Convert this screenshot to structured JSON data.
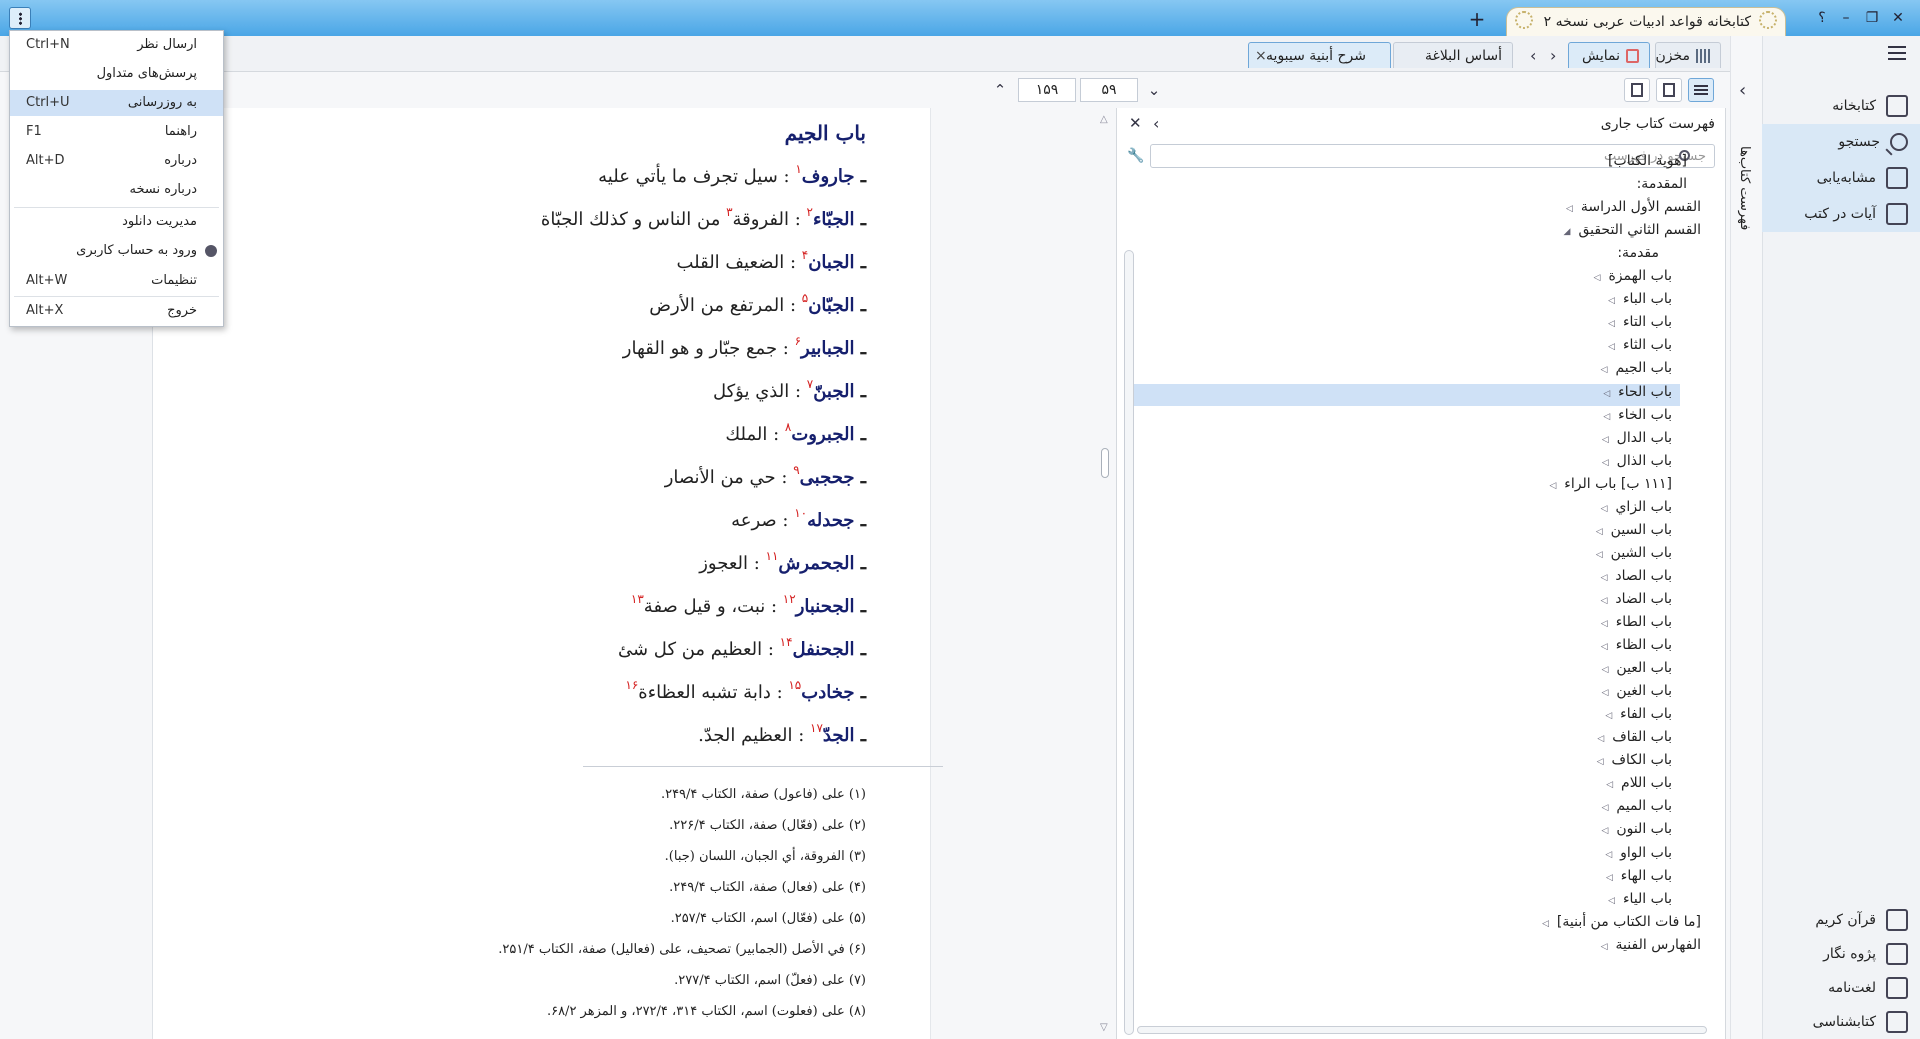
{
  "window": {
    "title": "کتابخانه قواعد ادبیات عربی نسخه ۲",
    "help": "؟",
    "minimize": "–",
    "restore": "❐",
    "close": "✕",
    "new_tab": "+"
  },
  "menu": {
    "items": [
      {
        "label": "ارسال نظر",
        "shortcut": "Ctrl+N"
      },
      {
        "label": "پرسش‌های متداول",
        "shortcut": ""
      },
      {
        "label": "به روزرسانی",
        "shortcut": "Ctrl+U"
      },
      {
        "label": "راهنما",
        "shortcut": "F1"
      },
      {
        "label": "درباره",
        "shortcut": "Alt+D"
      },
      {
        "label": "درباره نسخه",
        "shortcut": ""
      },
      {
        "label": "مدیریت دانلود",
        "shortcut": ""
      },
      {
        "label": "ورود به حساب کاربری",
        "shortcut": ""
      },
      {
        "label": "تنظیمات",
        "shortcut": "Alt+W"
      },
      {
        "label": "خروج",
        "shortcut": "Alt+X"
      }
    ]
  },
  "tabs": {
    "store": "مخزن",
    "display": "نمایش",
    "docs": [
      {
        "label": "أساس البلاغة"
      },
      {
        "label": "شرح أبنية سيبويه"
      }
    ],
    "close": "×"
  },
  "toolbar": {
    "page_current": "۵۹",
    "page_total": "۱۵۹"
  },
  "rightnav": {
    "top": [
      {
        "label": "کتابخانه"
      },
      {
        "label": "جستجو"
      },
      {
        "label": "مشابه‌یابی"
      },
      {
        "label": "آیات در کتب"
      }
    ],
    "bottom": [
      {
        "label": "قرآن کریم"
      },
      {
        "label": "پژوه نگار"
      },
      {
        "label": "لغت‌نامه"
      },
      {
        "label": "کتابشناسی"
      }
    ],
    "vertical_tab": "فهرست کتاب‌ها"
  },
  "toc": {
    "title": "فهرست کتاب جاری",
    "search_placeholder": "جستجو در فهرست",
    "items": [
      {
        "label": "[هوية الكتاب]",
        "level": 0,
        "tri": ""
      },
      {
        "label": "المقدمة:",
        "level": 0,
        "tri": ""
      },
      {
        "label": "القسم الأول الدراسة",
        "level": 0,
        "tri": "◁"
      },
      {
        "label": "القسم الثاني التحقيق",
        "level": 0,
        "tri": "◢"
      },
      {
        "label": "مقدمة:",
        "level": 1,
        "tri": ""
      },
      {
        "label": "باب الهمزة",
        "level": 1,
        "tri": "◁"
      },
      {
        "label": "باب الباء",
        "level": 1,
        "tri": "◁"
      },
      {
        "label": "باب التاء",
        "level": 1,
        "tri": "◁"
      },
      {
        "label": "باب الثاء",
        "level": 1,
        "tri": "◁"
      },
      {
        "label": "باب الجيم",
        "level": 1,
        "tri": "◁"
      },
      {
        "label": "باب الحاء",
        "level": 1,
        "tri": "◁"
      },
      {
        "label": "باب الخاء",
        "level": 1,
        "tri": "◁"
      },
      {
        "label": "باب الدال",
        "level": 1,
        "tri": "◁"
      },
      {
        "label": "باب الذال",
        "level": 1,
        "tri": "◁"
      },
      {
        "label": "[۱۱۱ ب] باب الراء",
        "level": 1,
        "tri": "◁"
      },
      {
        "label": "باب الزاي",
        "level": 1,
        "tri": "◁"
      },
      {
        "label": "باب السين",
        "level": 1,
        "tri": "◁"
      },
      {
        "label": "باب الشين",
        "level": 1,
        "tri": "◁"
      },
      {
        "label": "باب الصاد",
        "level": 1,
        "tri": "◁"
      },
      {
        "label": "باب الضاد",
        "level": 1,
        "tri": "◁"
      },
      {
        "label": "باب الطاء",
        "level": 1,
        "tri": "◁"
      },
      {
        "label": "باب الظاء",
        "level": 1,
        "tri": "◁"
      },
      {
        "label": "باب العين",
        "level": 1,
        "tri": "◁"
      },
      {
        "label": "باب الغين",
        "level": 1,
        "tri": "◁"
      },
      {
        "label": "باب الفاء",
        "level": 1,
        "tri": "◁"
      },
      {
        "label": "باب القاف",
        "level": 1,
        "tri": "◁"
      },
      {
        "label": "باب الكاف",
        "level": 1,
        "tri": "◁"
      },
      {
        "label": "باب اللام",
        "level": 1,
        "tri": "◁"
      },
      {
        "label": "باب الميم",
        "level": 1,
        "tri": "◁"
      },
      {
        "label": "باب النون",
        "level": 1,
        "tri": "◁"
      },
      {
        "label": "باب الواو",
        "level": 1,
        "tri": "◁"
      },
      {
        "label": "باب الهاء",
        "level": 1,
        "tri": "◁"
      },
      {
        "label": "باب الياء",
        "level": 1,
        "tri": "◁"
      },
      {
        "label": "[ما فات الكتاب من أبنية]",
        "level": 0,
        "tri": "◁"
      },
      {
        "label": "الفهارس الفنية",
        "level": 0,
        "tri": "◁"
      }
    ],
    "selected": "باب الجيم"
  },
  "reader": {
    "chapter_title": "باب الجيم",
    "entries": [
      {
        "head": "جاروف",
        "num": "۱",
        "text": " : سيل تجرف ما يأتي عليه",
        "num2": ""
      },
      {
        "head": "الجبّاء",
        "num": "۲",
        "text": " : الفروقة",
        "mid_num": "۳",
        "text2": " من الناس و كذلك الجبّاة",
        "num2": ""
      },
      {
        "head": "الجبان",
        "num": "۴",
        "text": " : الضعيف القلب",
        "num2": ""
      },
      {
        "head": "الجبّان",
        "num": "۵",
        "text": " : المرتفع من الأرض",
        "num2": ""
      },
      {
        "head": "الجبابير",
        "num": "۶",
        "text": " : جمع جبّار و هو القهار",
        "num2": ""
      },
      {
        "head": "الجبنّ",
        "num": "۷",
        "text": " : الذي يؤكل",
        "num2": ""
      },
      {
        "head": "الجبروت",
        "num": "۸",
        "text": " : الملك",
        "num2": ""
      },
      {
        "head": "جحجبى",
        "num": "۹",
        "text": " : حي من الأنصار",
        "num2": ""
      },
      {
        "head": "جحدله",
        "num": "۱۰",
        "text": " : صرعه",
        "num2": ""
      },
      {
        "head": "الجحمرش",
        "num": "۱۱",
        "text": " : العجوز",
        "num2": ""
      },
      {
        "head": "الجحنبار",
        "num": "۱۲",
        "text": " : نبت، و قيل صفة",
        "num2": "۱۳"
      },
      {
        "head": "الجحنفل",
        "num": "۱۴",
        "text": " : العظيم من كل شئ",
        "num2": ""
      },
      {
        "head": "جخادب",
        "num": "۱۵",
        "text": " : دابة تشبه العظاءة",
        "num2": "۱۶"
      },
      {
        "head": "الجدّ",
        "num": "۱۷",
        "text": " : العظيم الجدّ.",
        "num2": ""
      }
    ],
    "footnotes": [
      "(۱)  على (فاعول) صفة، الكتاب ۲۴۹/۴.",
      "(۲)  على (فعّال) صفة، الكتاب ۲۲۶/۴.",
      "(۳)  الفروقة، أي الجبان، اللسان (جبا).",
      "(۴)  على (فعال) صفة، الكتاب ۲۴۹/۴.",
      "(۵)  على (فعّال) اسم، الكتاب ۲۵۷/۴.",
      "(۶)  في الأصل (الجمابير) تصحيف، على (فعاليل) صفة، الكتاب ۲۵۱/۴.",
      "(۷)  على (فعلّ) اسم، الكتاب ۲۷۷/۴.",
      "(۸)  على (فعلوت) اسم، الكتاب ۳۱۴، ۲۷۲/۴، و المزهر ۶۸/۲."
    ]
  }
}
